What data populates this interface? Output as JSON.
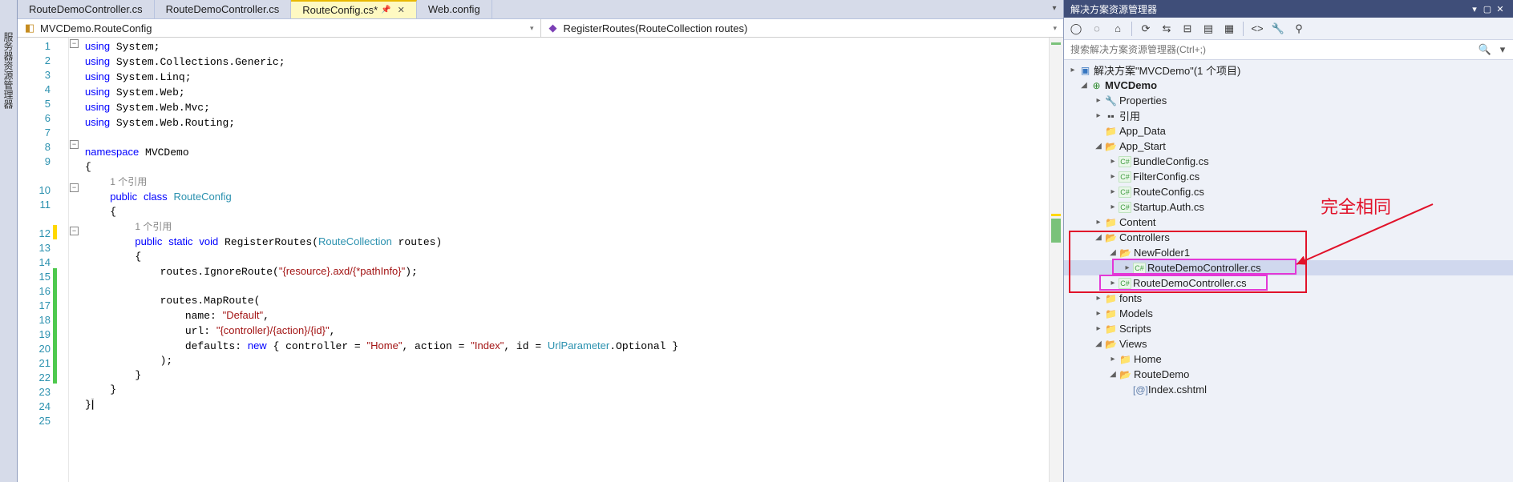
{
  "sidebar_collapsed_label": "服务器资源管理器",
  "tabs": [
    {
      "label": "RouteDemoController.cs",
      "active": false
    },
    {
      "label": "RouteDemoController.cs",
      "active": false
    },
    {
      "label": "RouteConfig.cs*",
      "active": true
    },
    {
      "label": "Web.config",
      "active": false
    }
  ],
  "nav": {
    "left": {
      "icon": "class-icon",
      "text": "MVCDemo.RouteConfig"
    },
    "right": {
      "icon": "method-icon",
      "text": "RegisterRoutes(RouteCollection routes)"
    }
  },
  "code_hint_1": "1 个引用",
  "code_hint_2": "1 个引用",
  "code_lines": {
    "l1": "using System;",
    "l2": "using System.Collections.Generic;",
    "l3": "using System.Linq;",
    "l4": "using System.Web;",
    "l5": "using System.Web.Mvc;",
    "l6": "using System.Web.Routing;",
    "l8": "namespace MVCDemo",
    "l10": "    public class RouteConfig",
    "l12": "        public static void RegisterRoutes(RouteCollection routes)",
    "l14": "            routes.IgnoreRoute(\"{resource}.axd/{*pathInfo}\");",
    "l16": "            routes.MapRoute(",
    "l17": "                name: \"Default\",",
    "l18": "                url: \"{controller}/{action}/{id}\",",
    "l19": "                defaults: new { controller = \"Home\", action = \"Index\", id = UrlParameter.Optional }",
    "l20": "            );"
  },
  "panel": {
    "title": "解决方案资源管理器",
    "search_placeholder": "搜索解决方案资源管理器(Ctrl+;)",
    "solution_text": "解决方案\"MVCDemo\"(1 个项目)",
    "project": "MVCDemo",
    "properties": "Properties",
    "references": "引用",
    "app_data": "App_Data",
    "app_start": "App_Start",
    "bundle": "BundleConfig.cs",
    "filter": "FilterConfig.cs",
    "route": "RouteConfig.cs",
    "startup": "Startup.Auth.cs",
    "content": "Content",
    "controllers": "Controllers",
    "newfolder": "NewFolder1",
    "routedemo1": "RouteDemoController.cs",
    "routedemo2": "RouteDemoController.cs",
    "fonts": "fonts",
    "models": "Models",
    "scripts": "Scripts",
    "views": "Views",
    "home": "Home",
    "routedemo_v": "RouteDemo",
    "index": "Index.cshtml"
  },
  "annotation_text": "完全相同"
}
